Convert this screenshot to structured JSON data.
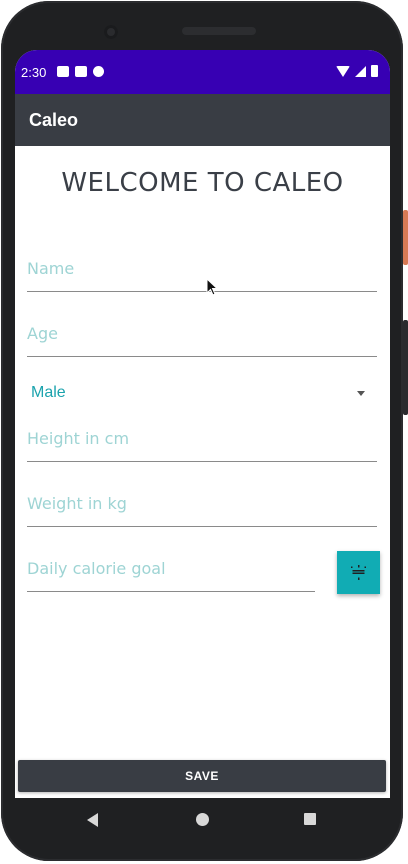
{
  "status_bar": {
    "time": "2:30",
    "background_color": "#3700b3",
    "left_icons": [
      "gmail-icon",
      "sd-card-icon",
      "data-saver-icon"
    ],
    "right_icons": [
      "wifi-icon",
      "signal-icon",
      "battery-icon"
    ]
  },
  "app_bar": {
    "title": "Caleo",
    "background_color": "#393d44"
  },
  "main": {
    "heading": "WELCOME TO CALEO",
    "fields": {
      "name_placeholder": "Name",
      "age_placeholder": "Age",
      "height_placeholder": "Height in cm",
      "weight_placeholder": "Weight in kg",
      "calorie_placeholder": "Daily calorie goal"
    },
    "gender_select": {
      "selected": "Male"
    },
    "calculate_button": {
      "icon": "calculator-icon",
      "color": "#11acb4"
    },
    "save_label": "SAVE"
  },
  "nav_bar": {
    "icons": [
      "back-icon",
      "home-icon",
      "recents-icon"
    ]
  },
  "colors": {
    "accent": "#11acb4",
    "placeholder": "#9ed4d4",
    "heading": "#3a3f47"
  }
}
